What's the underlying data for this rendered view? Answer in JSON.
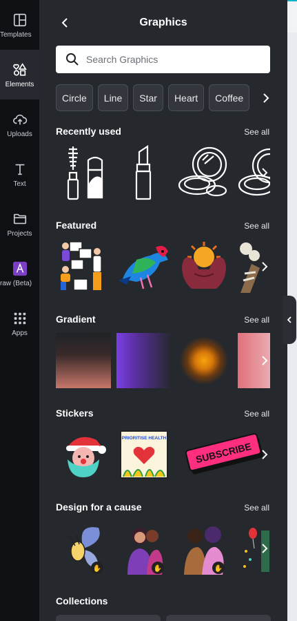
{
  "rail": {
    "items": [
      {
        "label": "Templates",
        "icon": "templates-icon"
      },
      {
        "label": "Elements",
        "icon": "elements-icon"
      },
      {
        "label": "Uploads",
        "icon": "upload-cloud-icon"
      },
      {
        "label": "Text",
        "icon": "text-icon"
      },
      {
        "label": "Projects",
        "icon": "folder-icon"
      },
      {
        "label": "raw (Beta)",
        "icon": "draw-icon"
      },
      {
        "label": "Apps",
        "icon": "apps-grid-icon"
      }
    ]
  },
  "header": {
    "title": "Graphics",
    "back_icon": "chevron-left-icon"
  },
  "search": {
    "placeholder": "Search Graphics"
  },
  "chips": [
    "Circle",
    "Line",
    "Star",
    "Heart",
    "Coffee"
  ],
  "sections": [
    {
      "title": "Recently used",
      "see_all": "See all"
    },
    {
      "title": "Featured",
      "see_all": "See all"
    },
    {
      "title": "Gradient",
      "see_all": "See all"
    },
    {
      "title": "Stickers",
      "see_all": "See all"
    },
    {
      "title": "Design for a cause",
      "see_all": "See all"
    },
    {
      "title": "Collections"
    }
  ],
  "stickers": {
    "prioritise_text": "PRIORITISE HEALTH",
    "subscribe_text": "SUBSCRIBE"
  },
  "colors": {
    "accent": "#0bb5c6",
    "panel": "#25282d",
    "rail": "#0e1014"
  }
}
